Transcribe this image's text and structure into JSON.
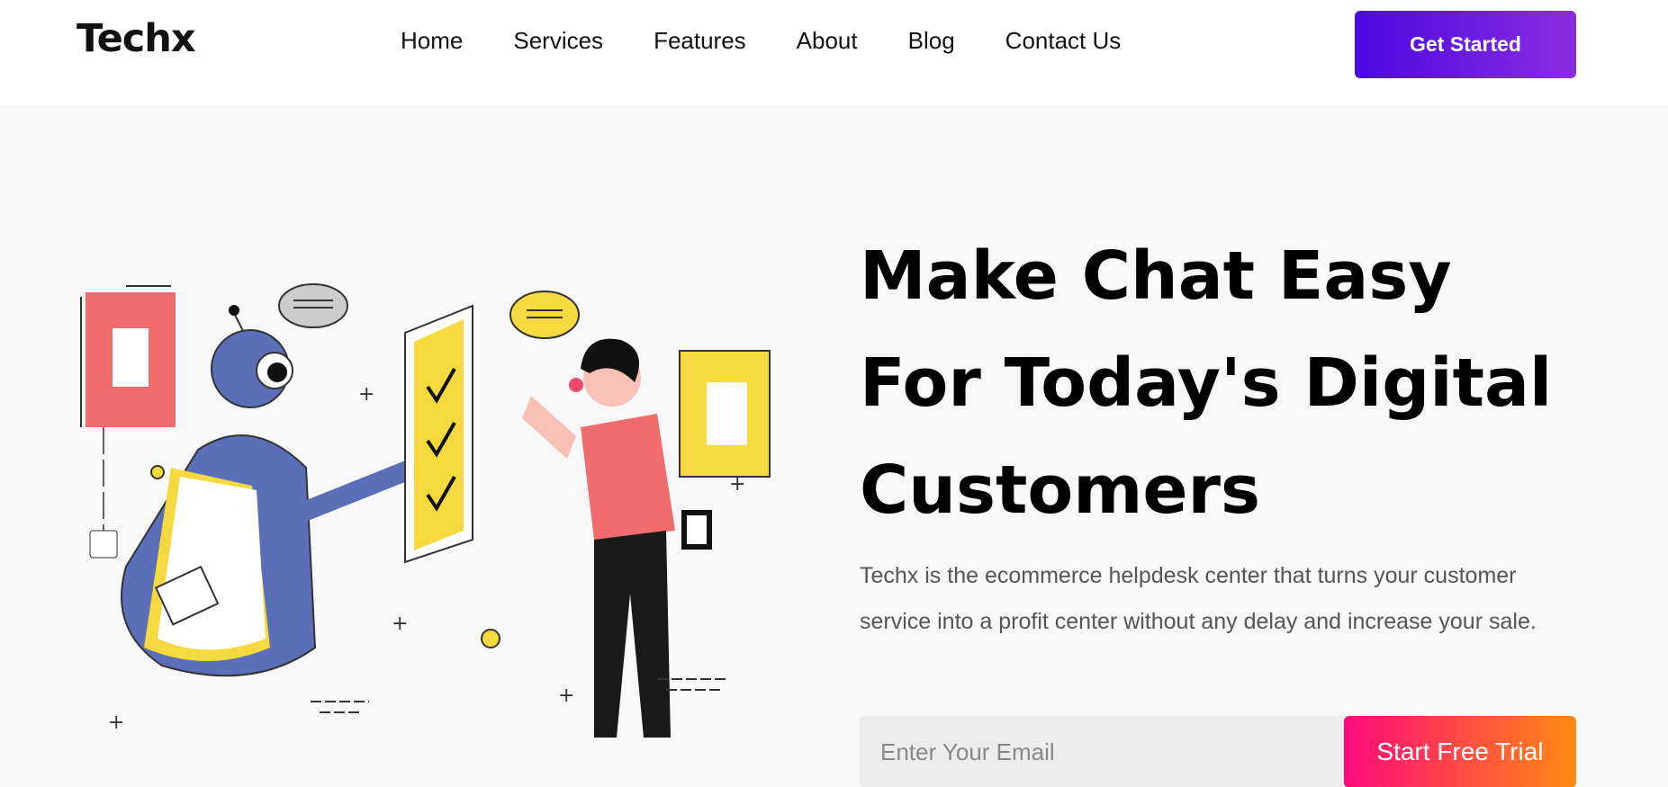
{
  "brand": {
    "name": "Techx"
  },
  "nav": {
    "items": [
      {
        "label": "Home"
      },
      {
        "label": "Services"
      },
      {
        "label": "Features"
      },
      {
        "label": "About"
      },
      {
        "label": "Blog"
      },
      {
        "label": "Contact Us"
      }
    ],
    "cta_label": "Get Started"
  },
  "hero": {
    "headline": [
      "Make Chat Easy",
      "For Today's Digital",
      "Customers"
    ],
    "description": "Techx is the ecommerce helpdesk center that turns your customer service into a profit center without any delay and increase your sale.",
    "email_placeholder": "Enter Your Email",
    "trial_label": "Start Free Trial",
    "illustration": "robot-and-person-chat-icon"
  },
  "colors": {
    "accent_purple": "#4b08e3",
    "accent_pink": "#ff0a7a",
    "accent_orange": "#ff8a12",
    "illustration_blue": "#5b6fb9",
    "illustration_yellow": "#f6d93f",
    "illustration_red": "#f06b6b"
  }
}
